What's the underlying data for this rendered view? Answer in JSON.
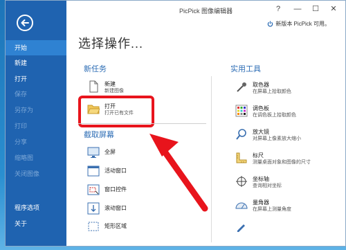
{
  "window": {
    "title": "PicPick 图像编辑器",
    "notice": "新版本 PicPick 可用。",
    "controls": {
      "help": "?",
      "minimize": "—",
      "maximize": "☐",
      "close": "✕"
    }
  },
  "sidebar": {
    "items": [
      {
        "label": "开始",
        "state": "active"
      },
      {
        "label": "新建",
        "state": "normal"
      },
      {
        "label": "打开",
        "state": "normal"
      },
      {
        "label": "保存",
        "state": "disabled"
      },
      {
        "label": "另存为",
        "state": "disabled"
      },
      {
        "label": "打印",
        "state": "disabled"
      },
      {
        "label": "分享",
        "state": "disabled"
      },
      {
        "label": "缩略图",
        "state": "disabled"
      },
      {
        "label": "关闭图像",
        "state": "disabled"
      },
      {
        "label": "程序选项",
        "state": "normal"
      },
      {
        "label": "关于",
        "state": "normal"
      }
    ]
  },
  "main": {
    "heading": "选择操作...",
    "new_task": {
      "title": "新任务",
      "items": [
        {
          "label": "新建",
          "desc": "新建图像",
          "icon": "new-file-icon"
        },
        {
          "label": "打开",
          "desc": "打开已有文件",
          "icon": "open-folder-icon"
        }
      ]
    },
    "capture": {
      "title": "截取屏幕",
      "items": [
        {
          "label": "全屏",
          "icon": "fullscreen-icon"
        },
        {
          "label": "活动窗口",
          "icon": "active-window-icon"
        },
        {
          "label": "窗口控件",
          "icon": "window-control-icon"
        },
        {
          "label": "滚动窗口",
          "icon": "scroll-window-icon"
        },
        {
          "label": "矩形区域",
          "icon": "rectangle-region-icon"
        }
      ]
    },
    "tools": {
      "title": "实用工具",
      "items": [
        {
          "label": "取色器",
          "desc": "在屏幕上拾取颜色",
          "icon": "color-picker-icon"
        },
        {
          "label": "调色板",
          "desc": "在调色板上拾取颜色",
          "icon": "palette-icon"
        },
        {
          "label": "放大镜",
          "desc": "对屏幕上像素放大缩小",
          "icon": "magnifier-icon"
        },
        {
          "label": "标尺",
          "desc": "测量桌面对象和图像的尺寸",
          "icon": "ruler-icon"
        },
        {
          "label": "坐标轴",
          "desc": "查询相对坐标",
          "icon": "crosshair-icon"
        },
        {
          "label": "量角器",
          "desc": "在屏幕上测量角度",
          "icon": "protractor-icon"
        }
      ]
    }
  },
  "colors": {
    "sidebar": "#1f63b0",
    "active": "#2f82d2",
    "section": "#2d6db5",
    "highlight": "#e8141c"
  }
}
